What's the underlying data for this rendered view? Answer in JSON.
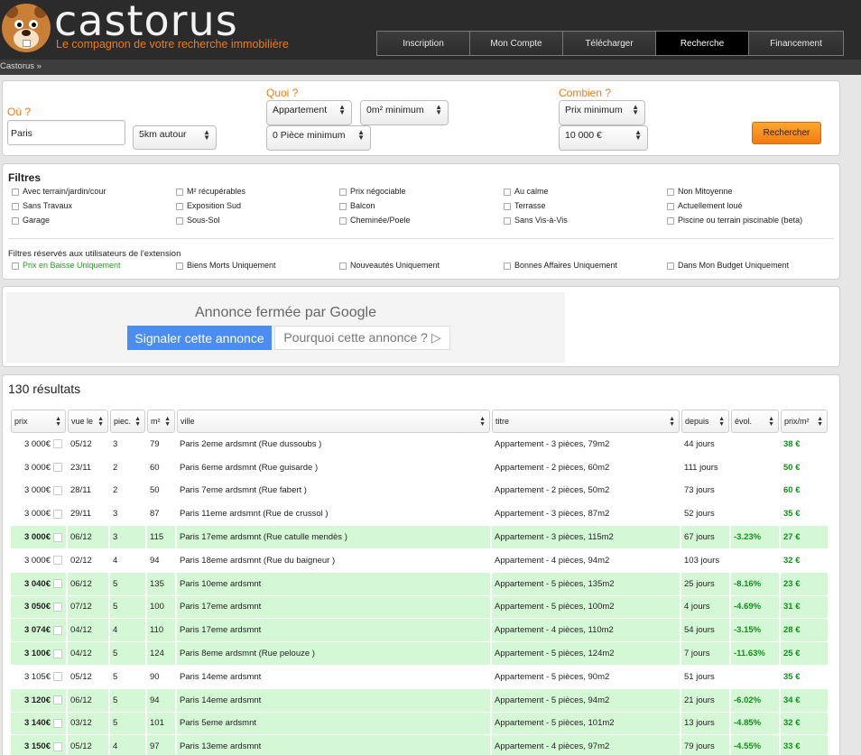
{
  "header": {
    "title": "castorus",
    "tagline": "Le compagnon de votre recherche immobilière",
    "tabs": [
      {
        "label": "Inscription",
        "active": false
      },
      {
        "label": "Mon Compte",
        "active": false
      },
      {
        "label": "Télécharger",
        "active": false
      },
      {
        "label": "Recherche",
        "active": true
      },
      {
        "label": "Financement",
        "active": false
      }
    ]
  },
  "breadcrumb": "Castorus »",
  "search": {
    "ou_label": "Où ?",
    "quoi_label": "Quoi ?",
    "combien_label": "Combien ?",
    "city_value": "Paris",
    "radius": "5km autour",
    "type": "Appartement",
    "surface": "0m² minimum",
    "rooms": "0 Pièce minimum",
    "price_mode": "Prix minimum",
    "price_value": "10 000 €",
    "search_button": "Rechercher"
  },
  "filters": {
    "title": "Filtres",
    "items": [
      "Avec terrain/jardin/cour",
      "M² récupérables",
      "Prix négociable",
      "Au calme",
      "Non Mitoyenne",
      "Sans Travaux",
      "Exposition Sud",
      "Balcon",
      "Terrasse",
      "Actuellement loué",
      "Garage",
      "Sous-Sol",
      "Cheminée/Poele",
      "Sans Vis-à-Vis",
      "Piscine ou terrain piscinable (beta)"
    ],
    "extension_label": "Filtres réservés aux utilisateurs de l'extension",
    "extension_items": [
      "Prix en Baisse Uniquement",
      "Biens Morts Uniquement",
      "Nouveautés Uniquement",
      "Bonnes Affaires Uniquement",
      "Dans Mon Budget Uniquement"
    ]
  },
  "ad": {
    "title": "Annonce fermée par Google",
    "report_button": "Signaler cette annonce",
    "why_button": "Pourquoi cette annonce ? ▷"
  },
  "results": {
    "count": "130 résultats",
    "columns": [
      "prix",
      "vue le",
      "piec.",
      "m²",
      "ville",
      "titre",
      "depuis",
      "évol.",
      "prix/m²"
    ],
    "rows": [
      {
        "price": "3 000€",
        "seen": "05/12",
        "rooms": "3",
        "m2": "79",
        "city": "Paris 2eme ardsmnt (Rue dussoubs )",
        "title": "Appartement - 3 pièces, 79m2",
        "since": "44 jours",
        "evol": "",
        "ppm": "38 €",
        "hl": false
      },
      {
        "price": "3 000€",
        "seen": "23/11",
        "rooms": "2",
        "m2": "60",
        "city": "Paris 6eme ardsmnt (Rue guisarde )",
        "title": "Appartement - 2 pièces, 60m2",
        "since": "111 jours",
        "evol": "",
        "ppm": "50 €",
        "hl": false
      },
      {
        "price": "3 000€",
        "seen": "28/11",
        "rooms": "2",
        "m2": "50",
        "city": "Paris 7eme ardsmnt (Rue fabert )",
        "title": "Appartement - 2 pièces, 50m2",
        "since": "73 jours",
        "evol": "",
        "ppm": "60 €",
        "hl": false
      },
      {
        "price": "3 000€",
        "seen": "29/11",
        "rooms": "3",
        "m2": "87",
        "city": "Paris 11eme ardsmnt (Rue de crussol )",
        "title": "Appartement - 3 pièces, 87m2",
        "since": "52 jours",
        "evol": "",
        "ppm": "35 €",
        "hl": false
      },
      {
        "price": "3 000€",
        "seen": "06/12",
        "rooms": "3",
        "m2": "115",
        "city": "Paris 17eme ardsmnt (Rue catulle mendès )",
        "title": "Appartement - 3 pièces, 115m2",
        "since": "67 jours",
        "evol": "-3.23%",
        "ppm": "27 €",
        "hl": true
      },
      {
        "price": "3 000€",
        "seen": "02/12",
        "rooms": "4",
        "m2": "94",
        "city": "Paris 18eme ardsmnt (Rue du baigneur )",
        "title": "Appartement - 4 pièces, 94m2",
        "since": "103 jours",
        "evol": "",
        "ppm": "32 €",
        "hl": false
      },
      {
        "price": "3 040€",
        "seen": "06/12",
        "rooms": "5",
        "m2": "135",
        "city": "Paris 10eme ardsmnt",
        "title": "Appartement - 5 pièces, 135m2",
        "since": "25 jours",
        "evol": "-8.16%",
        "ppm": "23 €",
        "hl": true
      },
      {
        "price": "3 050€",
        "seen": "07/12",
        "rooms": "5",
        "m2": "100",
        "city": "Paris 17eme ardsmnt",
        "title": "Appartement - 5 pièces, 100m2",
        "since": "4 jours",
        "evol": "-4.69%",
        "ppm": "31 €",
        "hl": true
      },
      {
        "price": "3 074€",
        "seen": "04/12",
        "rooms": "4",
        "m2": "110",
        "city": "Paris 17eme ardsmnt",
        "title": "Appartement - 4 pièces, 110m2",
        "since": "54 jours",
        "evol": "-3.15%",
        "ppm": "28 €",
        "hl": true
      },
      {
        "price": "3 100€",
        "seen": "04/12",
        "rooms": "5",
        "m2": "124",
        "city": "Paris 8eme ardsmnt (Rue pelouze )",
        "title": "Appartement - 5 pièces, 124m2",
        "since": "7 jours",
        "evol": "-11.63%",
        "ppm": "25 €",
        "hl": true
      },
      {
        "price": "3 105€",
        "seen": "05/12",
        "rooms": "5",
        "m2": "90",
        "city": "Paris 14eme ardsmnt",
        "title": "Appartement - 5 pièces, 90m2",
        "since": "51 jours",
        "evol": "",
        "ppm": "35 €",
        "hl": false
      },
      {
        "price": "3 120€",
        "seen": "06/12",
        "rooms": "5",
        "m2": "94",
        "city": "Paris 14eme ardsmnt",
        "title": "Appartement - 5 pièces, 94m2",
        "since": "21 jours",
        "evol": "-6.02%",
        "ppm": "34 €",
        "hl": true
      },
      {
        "price": "3 140€",
        "seen": "03/12",
        "rooms": "5",
        "m2": "101",
        "city": "Paris 5eme ardsmnt",
        "title": "Appartement - 5 pièces, 101m2",
        "since": "13 jours",
        "evol": "-4.85%",
        "ppm": "32 €",
        "hl": true
      },
      {
        "price": "3 150€",
        "seen": "05/12",
        "rooms": "4",
        "m2": "97",
        "city": "Paris 13eme ardsmnt",
        "title": "Appartement - 4 pièces, 97m2",
        "since": "79 jours",
        "evol": "-4.55%",
        "ppm": "33 €",
        "hl": true
      }
    ]
  },
  "colors": {
    "brand_orange": "#f07b12",
    "header_bg": "#2b2b2b",
    "highlight_row": "#d4f8d6",
    "positive_green": "#12901a"
  }
}
